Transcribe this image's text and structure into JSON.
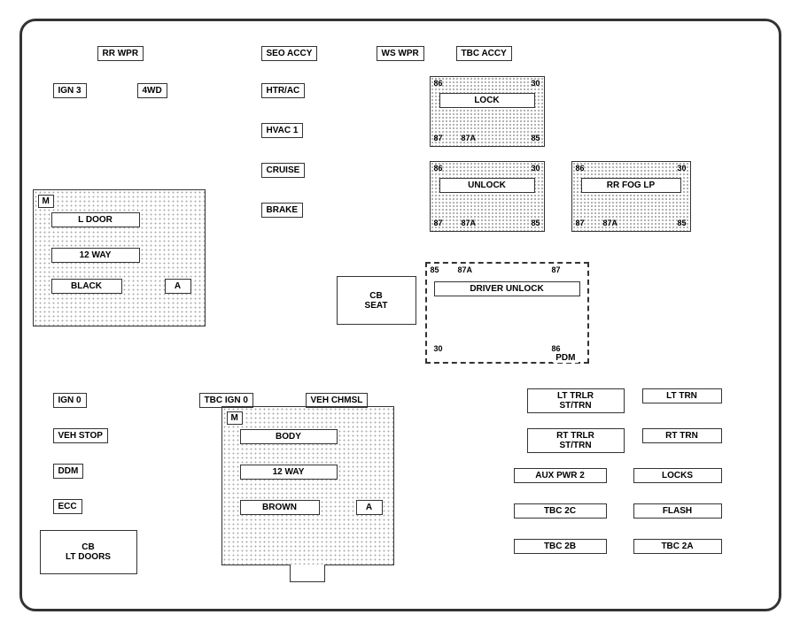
{
  "labels": {
    "rr_wpr": "RR WPR",
    "seo_accy": "SEO ACCY",
    "ws_wpr": "WS WPR",
    "tbc_accy": "TBC ACCY",
    "ign3": "IGN 3",
    "fwd": "4WD",
    "htr_ac": "HTR/AC",
    "hvac1": "HVAC 1",
    "cruise": "CRUISE",
    "brake": "BRAKE",
    "lock_relay": "LOCK",
    "unlock_relay": "UNLOCK",
    "rr_fog_lp": "RR FOG LP",
    "driver_unlock": "DRIVER UNLOCK",
    "pdm": "PDM",
    "cb_seat": "CB\nSEAT",
    "ign0": "IGN 0",
    "tbc_ign0": "TBC IGN 0",
    "veh_chmsl": "VEH CHMSL",
    "veh_stop": "VEH STOP",
    "ddm": "DDM",
    "ecc": "ECC",
    "cb_lt_doors": "CB\nLT DOORS",
    "l_door": "L DOOR",
    "black": "BLACK",
    "body": "BODY",
    "brown": "BROWN",
    "lt_trlr": "LT TRLR\nST/TRN",
    "lt_trn": "LT TRN",
    "rt_trlr": "RT TRLR\nST/TRN",
    "rt_trn": "RT TRN",
    "aux_pwr2": "AUX PWR 2",
    "locks": "LOCKS",
    "tbc_2c": "TBC 2C",
    "flash": "FLASH",
    "tbc_2b": "TBC 2B",
    "tbc_2a": "TBC 2A",
    "way12": "12 WAY",
    "a": "A",
    "m": "M",
    "n86": "86",
    "n30": "30",
    "n87": "87",
    "n87a": "87A",
    "n85": "85"
  }
}
